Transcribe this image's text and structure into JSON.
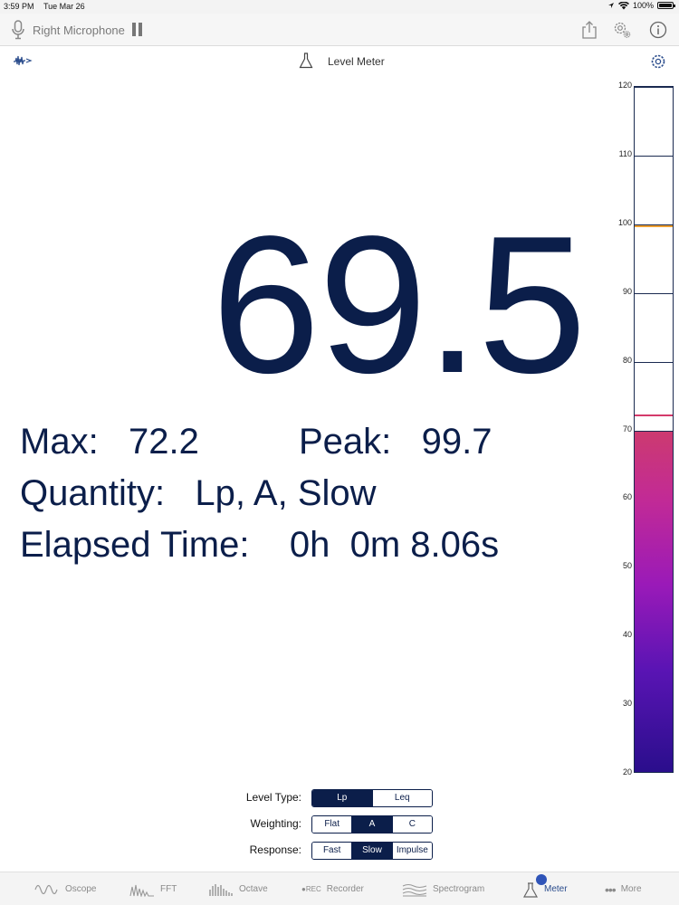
{
  "status_bar": {
    "time": "3:59 PM",
    "date": "Tue Mar 26",
    "battery": "100%"
  },
  "toolbar": {
    "input_label": "Right Microphone"
  },
  "header": {
    "title": "Level Meter"
  },
  "reading": {
    "value": "69.5"
  },
  "stats": {
    "max_line": "Max:   72.2",
    "peak_line": "Peak:   99.7",
    "quantity_line": "Quantity:   Lp, A, Slow",
    "elapsed_line": "Elapsed Time:    0h  0m 8.06s"
  },
  "meter": {
    "scale_min": 20,
    "scale_max": 120,
    "level": 69.5,
    "max": 72.2,
    "peak": 99.7,
    "tick_labels": [
      "120",
      "110",
      "100",
      "90",
      "80",
      "70",
      "60",
      "50",
      "40",
      "30",
      "20"
    ]
  },
  "controls": {
    "level_type": {
      "label": "Level Type:",
      "options": [
        "Lp",
        "Leq"
      ],
      "selected": "Lp"
    },
    "weighting": {
      "label": "Weighting:",
      "options": [
        "Flat",
        "A",
        "C"
      ],
      "selected": "A"
    },
    "response": {
      "label": "Response:",
      "options": [
        "Fast",
        "Slow",
        "Impulse"
      ],
      "selected": "Slow"
    }
  },
  "tabs": [
    {
      "label": "Oscope"
    },
    {
      "label": "FFT"
    },
    {
      "label": "Octave"
    },
    {
      "label": "Recorder",
      "prefix": "REC"
    },
    {
      "label": "Spectrogram"
    },
    {
      "label": "Meter",
      "active": true
    },
    {
      "label": "More"
    }
  ],
  "colors": {
    "accent": "#0b1e4a",
    "active_tab": "#2a4c8c"
  }
}
